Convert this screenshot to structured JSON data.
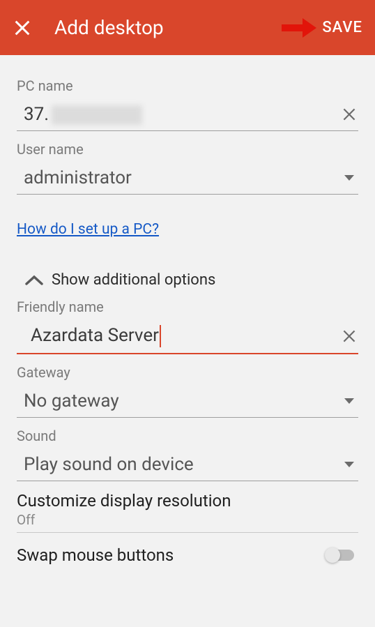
{
  "header": {
    "title": "Add desktop",
    "save_label": "SAVE"
  },
  "pc_name": {
    "label": "PC name",
    "value": "37."
  },
  "user_name": {
    "label": "User name",
    "value": "administrator"
  },
  "help_link": "How do I set up a PC?",
  "additional_toggle": "Show additional options",
  "friendly_name": {
    "label": "Friendly name",
    "value": "Azardata Server"
  },
  "gateway": {
    "label": "Gateway",
    "value": "No gateway"
  },
  "sound": {
    "label": "Sound",
    "value": "Play sound on device"
  },
  "display_resolution": {
    "title": "Customize display resolution",
    "value": "Off"
  },
  "swap_mouse": {
    "title": "Swap mouse buttons",
    "state": "off"
  }
}
